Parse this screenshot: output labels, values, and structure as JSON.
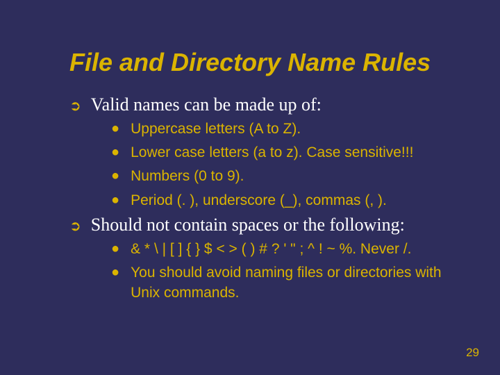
{
  "title": "File and Directory Name Rules",
  "sections": [
    {
      "heading": "Valid names can be made up of:",
      "items": [
        "Uppercase letters (A to Z).",
        "Lower case letters (a to z).  Case sensitive!!!",
        "Numbers (0 to 9).",
        "Period (. ), underscore (_), commas (, )."
      ]
    },
    {
      "heading": "Should not contain spaces or the following:",
      "items": [
        "& * \\ | [ ] { } $ < > ( ) # ? ' \" ; ^ ! ~ %.  Never /.",
        "You should avoid naming files or directories with Unix commands."
      ]
    }
  ],
  "page_number": "29"
}
